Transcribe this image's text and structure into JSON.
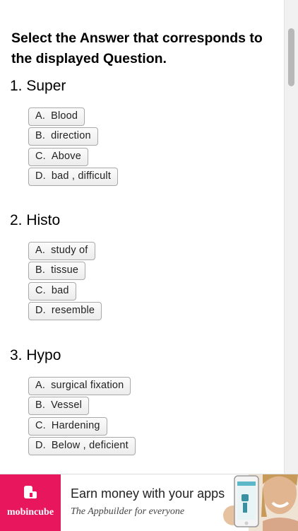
{
  "quiz": {
    "heading": "Select the Answer that corresponds to the displayed Question.",
    "questions": [
      {
        "label": "1. Super",
        "options": [
          {
            "letter": "A.",
            "text": "Blood"
          },
          {
            "letter": "B.",
            "text": "direction"
          },
          {
            "letter": "C.",
            "text": "Above"
          },
          {
            "letter": "D.",
            "text": "bad , difficult"
          }
        ]
      },
      {
        "label": "2. Histo",
        "options": [
          {
            "letter": "A.",
            "text": "study of"
          },
          {
            "letter": "B.",
            "text": "tissue"
          },
          {
            "letter": "C.",
            "text": "bad"
          },
          {
            "letter": "D.",
            "text": "resemble"
          }
        ]
      },
      {
        "label": "3. Hypo",
        "options": [
          {
            "letter": "A.",
            "text": "surgical fixation"
          },
          {
            "letter": "B.",
            "text": "Vessel"
          },
          {
            "letter": "C.",
            "text": "Hardening"
          },
          {
            "letter": "D.",
            "text": "Below , deficient"
          }
        ]
      }
    ]
  },
  "ad": {
    "brand": "mobincube",
    "title": "Earn money with your apps",
    "subtitle": "The Appbuilder for everyone",
    "brand_color": "#e8175d",
    "icons": [
      "mobincube-logo-icon",
      "phone-with-woman-image"
    ]
  }
}
